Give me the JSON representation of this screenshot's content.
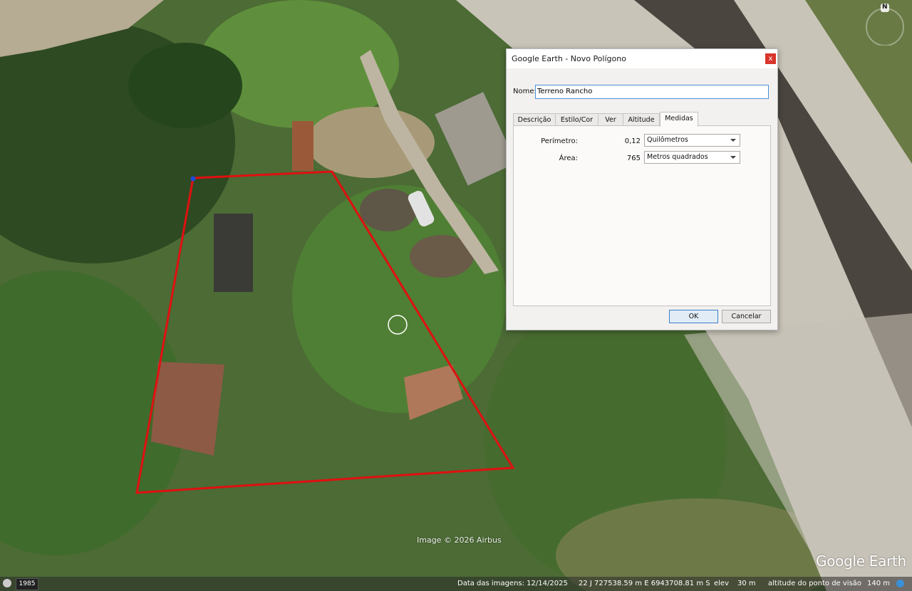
{
  "dialog": {
    "title": "Google Earth - Novo Polígono",
    "close_label": "x",
    "name_label": "Nome:",
    "name_value": "Terreno Rancho",
    "tabs": [
      {
        "label": "Descrição",
        "active": false
      },
      {
        "label": "Estilo/Cor",
        "active": false
      },
      {
        "label": "Ver",
        "active": false
      },
      {
        "label": "Altitude",
        "active": false
      },
      {
        "label": "Medidas",
        "active": true
      }
    ],
    "perimeter": {
      "label": "Perímetro:",
      "value": "0,12",
      "unit": "Quilômetros"
    },
    "area": {
      "label": "Área:",
      "value": "765",
      "unit": "Metros quadrados"
    },
    "ok_label": "OK",
    "cancel_label": "Cancelar"
  },
  "map": {
    "copyright": "Image © 2026 Airbus",
    "logo": "Google Earth",
    "compass_north": "N",
    "polygon_color": "#e01010"
  },
  "status_bar": {
    "year": "1985",
    "image_date": "Data das imagens: 12/14/2025",
    "coordinates": "22 J 727538.59 m E 6943708.81 m S",
    "elev_label": "elev",
    "elev_value": "30 m",
    "eye_alt_label": "altitude do ponto de visão",
    "eye_alt_value": "140 m"
  }
}
